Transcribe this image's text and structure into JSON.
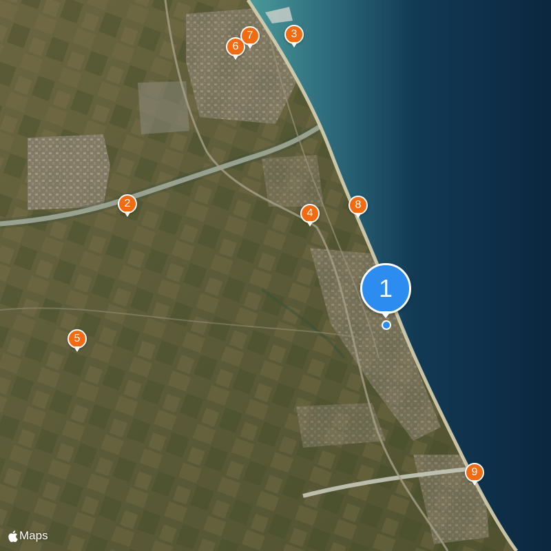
{
  "map": {
    "attribution": "Maps",
    "colors": {
      "sea_deep": "#0d2a42",
      "sea_shallow": "#3e8f95",
      "land": "#5b5a3a",
      "beach": "#d8d0b0",
      "river": "#bfc3b4",
      "pin_orange": "#f26a12",
      "pin_blue": "#2d8cf0"
    },
    "selected_pin": {
      "label": "1"
    },
    "pins": [
      {
        "label": "2"
      },
      {
        "label": "3"
      },
      {
        "label": "4"
      },
      {
        "label": "5"
      },
      {
        "label": "6"
      },
      {
        "label": "7"
      },
      {
        "label": "8"
      },
      {
        "label": "9"
      }
    ]
  }
}
